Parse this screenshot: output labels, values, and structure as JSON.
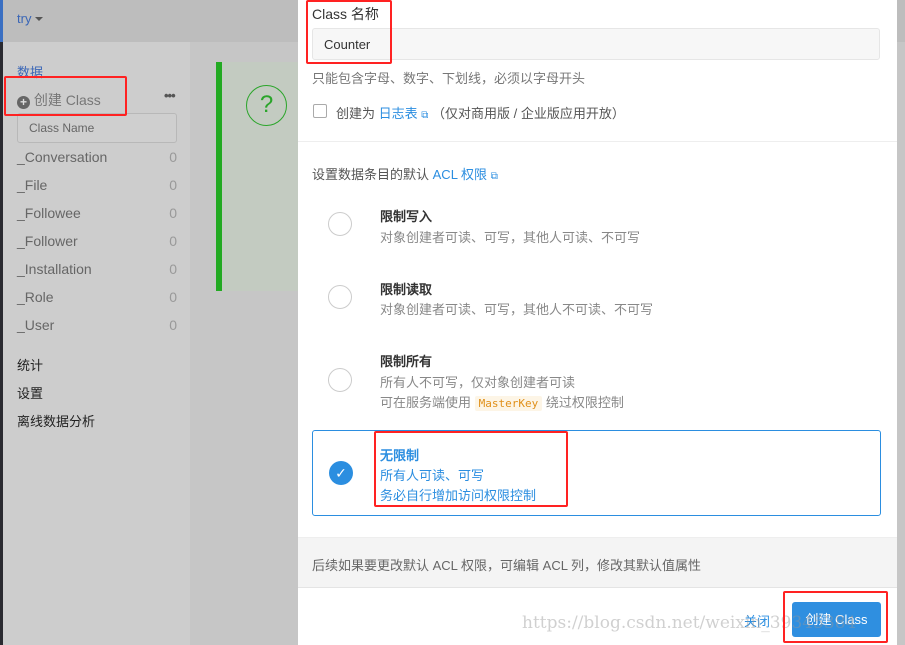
{
  "app": {
    "name": "try"
  },
  "sidebar": {
    "section_data": "数据",
    "create_label": "创建 Class",
    "more": "•••",
    "class_name_placeholder": "Class Name",
    "classes": [
      {
        "name": "_Conversation",
        "count": "0"
      },
      {
        "name": "_File",
        "count": "0"
      },
      {
        "name": "_Followee",
        "count": "0"
      },
      {
        "name": "_Follower",
        "count": "0"
      },
      {
        "name": "_Installation",
        "count": "0"
      },
      {
        "name": "_Role",
        "count": "0"
      },
      {
        "name": "_User",
        "count": "0"
      }
    ],
    "sections": [
      "统计",
      "设置",
      "离线数据分析"
    ]
  },
  "main": {
    "help_icon": "?"
  },
  "modal": {
    "name_label": "Class 名称",
    "name_value": "Counter",
    "name_help": "只能包含字母、数字、下划线，必须以字母开头",
    "log_prefix": "创建为",
    "log_link": "日志表",
    "log_suffix": "（仅对商用版 / 企业版应用开放）",
    "acl_prefix": "设置数据条目的默认",
    "acl_link": "ACL 权限",
    "options": [
      {
        "title": "限制写入",
        "desc": [
          "对象创建者可读、可写，其他人可读、不可写"
        ],
        "selected": false
      },
      {
        "title": "限制读取",
        "desc": [
          "对象创建者可读、可写，其他人不可读、不可写"
        ],
        "selected": false
      },
      {
        "title": "限制所有",
        "desc": [
          "所有人不可写，仅对象创建者可读"
        ],
        "desc2_prefix": "可在服务端使用",
        "desc2_code": "MasterKey",
        "desc2_suffix": "绕过权限控制",
        "selected": false
      },
      {
        "title": "无限制",
        "desc": [
          "所有人可读、可写",
          "务必自行增加访问权限控制"
        ],
        "selected": true
      }
    ],
    "footer_note": "后续如果要更改默认 ACL 权限，可编辑 ACL 列，修改其默认值属性",
    "close_label": "关闭",
    "create_label": "创建 Class"
  },
  "watermark": "https://blog.csdn.net/weixin_39345384",
  "colors": {
    "accent": "#2b8ee0",
    "highlight": "#ff2222",
    "success": "#22aa22"
  }
}
